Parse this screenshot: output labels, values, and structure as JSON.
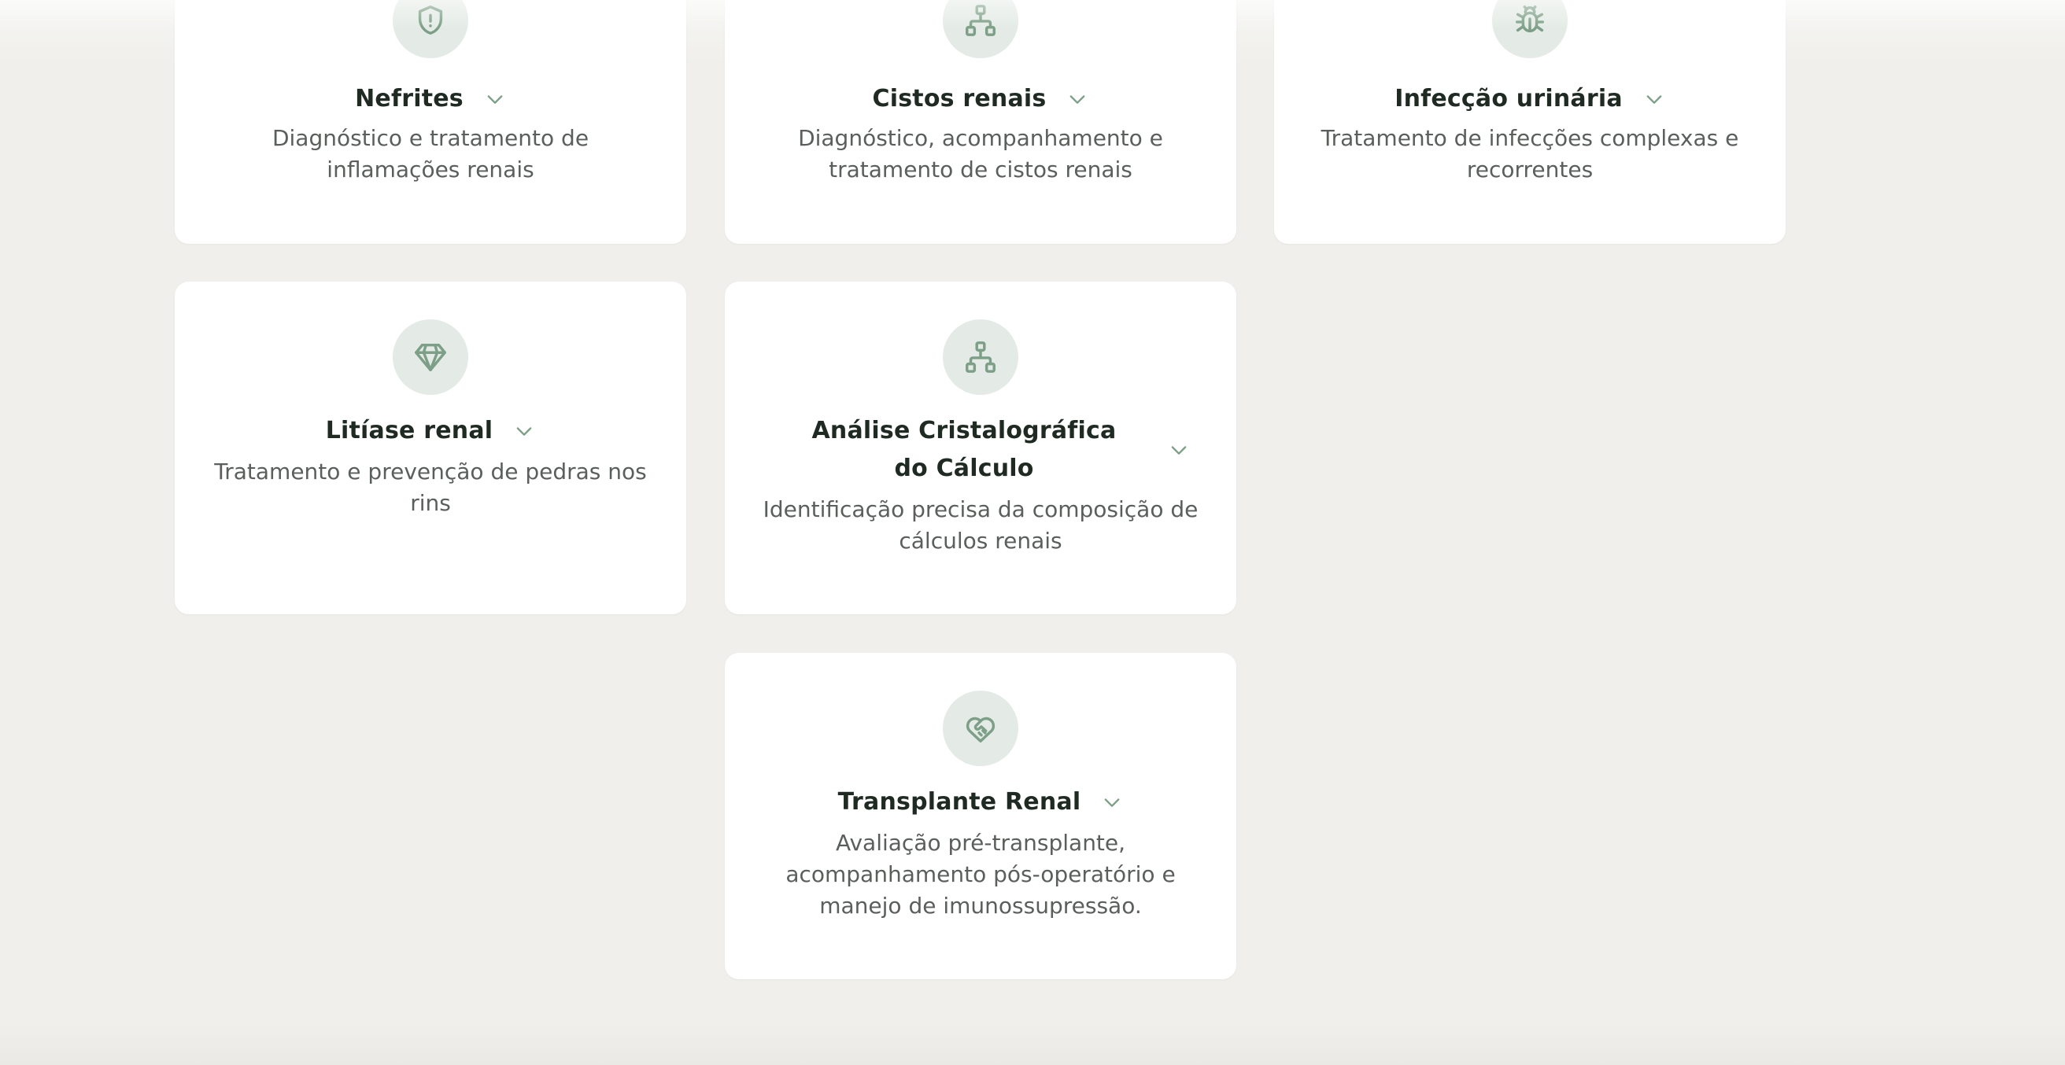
{
  "cards": [
    {
      "title": "Nefrites",
      "description": "Diagnóstico e tratamento de inflamações renais",
      "icon": "shield-icon"
    },
    {
      "title": "Cistos renais",
      "description": "Diagnóstico, acompanhamento e tratamento de cistos renais",
      "icon": "network-icon"
    },
    {
      "title": "Infecção urinária",
      "description": "Tratamento de infecções complexas e recorrentes",
      "icon": "bug-icon"
    },
    {
      "title": "Litíase renal",
      "description": "Tratamento e prevenção de pedras nos rins",
      "icon": "gem-icon"
    },
    {
      "title": "Análise Cristalográfica do Cálculo",
      "description": "Identificação precisa da composição de cálculos renais",
      "icon": "network-icon"
    },
    {
      "title": "Transplante Renal",
      "description": "Avaliação pré-transplante, acompanhamento pós-operatório e manejo de imunossupressão.",
      "icon": "heart-handshake-icon"
    }
  ],
  "colors": {
    "background": "#f0efeb",
    "card": "#ffffff",
    "icon_circle": "#e4ebe6",
    "icon_stroke": "#7d9f87",
    "title": "#1f2a23",
    "description": "#5a5f5c",
    "chevron": "#7d9f87"
  }
}
